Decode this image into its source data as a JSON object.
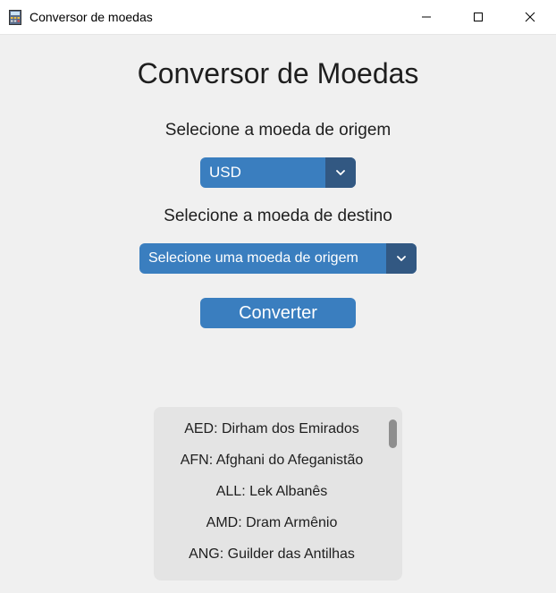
{
  "window": {
    "title": "Conversor de moedas",
    "icon": "calculator-app-icon"
  },
  "main": {
    "title": "Conversor de Moedas",
    "origin_label": "Selecione a moeda de origem",
    "origin_value": "USD",
    "dest_label": "Selecione a moeda de destino",
    "dest_value": "Selecione uma moeda de origem",
    "convert_label": "Converter"
  },
  "currency_list": {
    "items": [
      "AED: Dirham dos Emirados",
      "AFN: Afghani do Afeganistão",
      "ALL: Lek Albanês",
      "AMD: Dram Armênio",
      "ANG: Guilder das Antilhas"
    ]
  },
  "colors": {
    "accent": "#3a7ebf",
    "accent_dark": "#325882",
    "background": "#f0f0f0",
    "list_background": "#e4e4e4"
  }
}
